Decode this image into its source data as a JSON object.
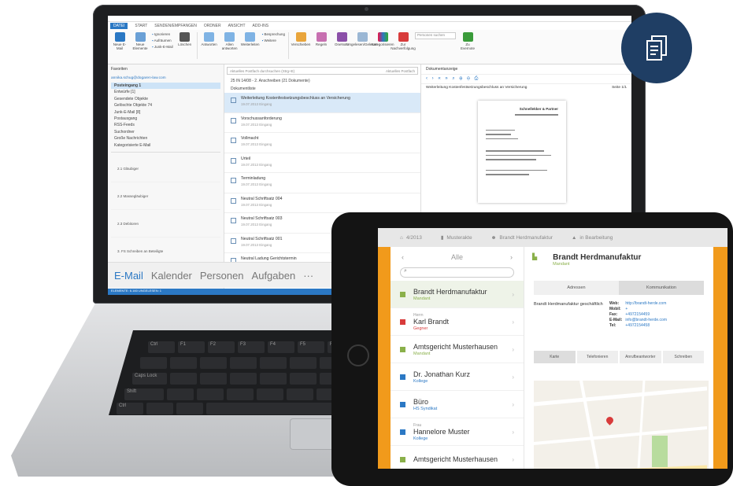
{
  "laptop": {
    "menu": [
      "DATEI",
      "START",
      "SENDEN/EMPFANGEN",
      "ORDNER",
      "ANSICHT",
      "ADD-INS"
    ],
    "ribbon_buttons": [
      {
        "label": "Neue E-Mail",
        "icon": "new-mail-icon"
      },
      {
        "label": "Neue Elemente",
        "icon": "new-items-icon"
      },
      {
        "label": "Löschen",
        "icon": "delete-icon"
      },
      {
        "label": "Antworten",
        "icon": "reply-icon"
      },
      {
        "label": "Allen antworten",
        "icon": "reply-all-icon"
      },
      {
        "label": "Weiterleiten",
        "icon": "forward-icon"
      },
      {
        "label": "Verschieben",
        "icon": "move-icon"
      },
      {
        "label": "Regeln",
        "icon": "rules-icon"
      },
      {
        "label": "OneNote",
        "icon": "onenote-icon"
      },
      {
        "label": "Ungelesen/Gelesen",
        "icon": "read-icon"
      },
      {
        "label": "Kategorisieren",
        "icon": "category-icon"
      },
      {
        "label": "Zur Nachverfolgung",
        "icon": "flag-icon"
      },
      {
        "label": "Zu Evernote",
        "icon": "evernote-icon"
      }
    ],
    "ribbon_small": [
      "Ignorieren",
      "Aufräumen",
      "Junk-E-Mail",
      "Besprechung",
      "Weitere"
    ],
    "ribbon_search_placeholder": "Personen suchen",
    "folders": {
      "favorites": "Favoriten",
      "account": "annika.schug@dogaren-law.com",
      "items": [
        {
          "label": "Posteingang 1",
          "selected": true
        },
        {
          "label": "Entwürfe [1]",
          "selected": false
        },
        {
          "label": "Gesendete Objekte",
          "selected": false
        },
        {
          "label": "Gelöschte Objekte 74",
          "selected": false
        },
        {
          "label": "Junk-E-Mail [8]",
          "selected": false
        },
        {
          "label": "Postausgang",
          "selected": false
        },
        {
          "label": "RSS-Feeds",
          "selected": false
        },
        {
          "label": "Suchordner",
          "selected": false
        },
        {
          "label": "Große Nachrichten",
          "selected": false
        },
        {
          "label": "Kategorisierte E-Mail",
          "selected": false
        }
      ],
      "tree": [
        "2.1 Gläubiger",
        "2.2 Massegläubiger",
        "2.3 Debitoren",
        "3. FS Schreiben an Beteiligte",
        "4. Debitoren",
        "5. Sonstiges"
      ]
    },
    "list": {
      "search_placeholder": "Aktuelles Postfach durchsuchen (Strg+E)",
      "scope": "Aktuelles Postfach",
      "header": "25 IN 14/08 - 2. Anschreiben (21 Dokumente)",
      "subheader": "Dokumentliste",
      "items": [
        {
          "title": "Weiterleitung Kostenfestsetzungsbeschluss an Versicherung",
          "sub": "19.07.2013 Eingang",
          "selected": true
        },
        {
          "title": "Vorschussanforderung",
          "sub": "19.07.2013 Eingang",
          "selected": false
        },
        {
          "title": "Vollmacht",
          "sub": "19.07.2013 Eingang",
          "selected": false
        },
        {
          "title": "Urteil",
          "sub": "19.07.2013 Eingang",
          "selected": false
        },
        {
          "title": "Terminladung",
          "sub": "19.07.2013 Eingang",
          "selected": false
        },
        {
          "title": "Neutral Schriftsatz 004",
          "sub": "19.07.2013 Eingang",
          "selected": false
        },
        {
          "title": "Neutral Schriftsatz 003",
          "sub": "19.07.2013 Eingang",
          "selected": false
        },
        {
          "title": "Neutral Schriftsatz 001",
          "sub": "19.07.2013 Eingang",
          "selected": false
        },
        {
          "title": "Neutral Ladung Gerichtstermin",
          "sub": "19.07.2013 Eingang",
          "selected": false
        },
        {
          "title": "Neutral Klageschrift",
          "sub": "19.07.2013 Eingang",
          "selected": false
        },
        {
          "title": "Neutral Gehaltsnachforderung",
          "sub": "19.07.2013 Eingang",
          "selected": false
        }
      ]
    },
    "preview": {
      "header": "Dokumentanzeige",
      "title": "Weiterleitung Kostenfestsetzungsbeschluss an Versicherung",
      "page": "Seite 1/1",
      "company": "Schnellekker & Partner"
    },
    "nav": [
      "E-Mail",
      "Kalender",
      "Personen",
      "Aufgaben",
      "···"
    ],
    "status": "ELEMENTE: 6.160   UNGELESEN: 1",
    "connection": "Verbunden"
  },
  "tablet": {
    "top": [
      {
        "label": "4/2013",
        "icon": "home-icon"
      },
      {
        "label": "Musterakte",
        "icon": "file-icon"
      },
      {
        "label": "Brandt Herdmanufaktur",
        "icon": "person-icon"
      },
      {
        "label": "in Bearbeitung",
        "icon": "warning-icon"
      }
    ],
    "list_title": "Alle",
    "search_placeholder": "",
    "items": [
      {
        "prefix": "",
        "name": "Brandt Herdmanufaktur",
        "sub": "Mandant",
        "sub_color": "#8ab04a",
        "icon_color": "#8ab04a",
        "selected": true
      },
      {
        "prefix": "Herrn",
        "name": "Karl Brandt",
        "sub": "Gegner",
        "sub_color": "#d83b3b",
        "icon_color": "#d83b3b",
        "selected": false
      },
      {
        "prefix": "",
        "name": "Amtsgericht Musterhausen",
        "sub": "Mandant",
        "sub_color": "#8ab04a",
        "icon_color": "#8ab04a",
        "selected": false
      },
      {
        "prefix": "",
        "name": "Dr. Jonathan Kurz",
        "sub": "Kollege",
        "sub_color": "#2b78c4",
        "icon_color": "#2b78c4",
        "selected": false
      },
      {
        "prefix": "",
        "name": "Büro",
        "sub": "HS Syndikat",
        "sub_color": "#2b78c4",
        "icon_color": "#2b78c4",
        "selected": false
      },
      {
        "prefix": "Frau",
        "name": "Hannelore Muster",
        "sub": "Kollege",
        "sub_color": "#2b78c4",
        "icon_color": "#2b78c4",
        "selected": false
      },
      {
        "prefix": "",
        "name": "Amtsgericht Musterhausen",
        "sub": "",
        "sub_color": "#8ab04a",
        "icon_color": "#8ab04a",
        "selected": false
      }
    ],
    "detail": {
      "name": "Brandt Herdmanufaktur",
      "role": "Mandant",
      "tabs": [
        "Adressen",
        "Kommunikation"
      ],
      "address": "Brandt Herdmanufaktur geschäftlich",
      "contact": [
        {
          "k": "Web:",
          "v": "http://brandt-herde.com"
        },
        {
          "k": "Mobil:",
          "v": "+"
        },
        {
          "k": "Fax:",
          "v": "+4972154459"
        },
        {
          "k": "E-Mail:",
          "v": "info@brandt-herde.com"
        },
        {
          "k": "Tel:",
          "v": "+4972154458"
        }
      ],
      "map_tabs": [
        "Karte",
        "Telefonieren",
        "Anrufbeantworter",
        "Schreiben"
      ]
    }
  },
  "colors": {
    "accent": "#2b78c4",
    "orange": "#f19a1b",
    "badge": "#1f3e64"
  }
}
